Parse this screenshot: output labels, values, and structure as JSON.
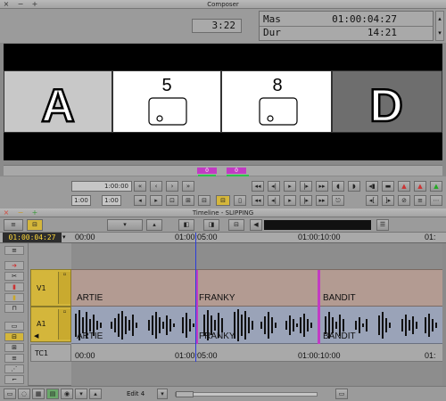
{
  "composer": {
    "title": "Composer",
    "duration_display": "3:22",
    "mas_label": "Mas",
    "mas_value": "01:00:04:27",
    "dur_label": "Dur",
    "dur_value": "14:21",
    "frames": [
      {
        "letter": "A",
        "number": "",
        "style": "light"
      },
      {
        "letter": "",
        "number": "5",
        "style": "white"
      },
      {
        "letter": "",
        "number": "8",
        "style": "white"
      },
      {
        "letter": "D",
        "number": "",
        "style": "dark"
      }
    ],
    "position_markers": [
      "0",
      "0"
    ],
    "timecode_field": "1:00:00",
    "in_field": "1:00",
    "out_field": "1:00"
  },
  "timeline": {
    "title": "Timeline - SLIPPING",
    "current_tc": "01:00:04:27",
    "ruler": [
      "00:00",
      "01:00:05:00",
      "01:00:10:00",
      "01:"
    ],
    "tracks": [
      {
        "name": "V1",
        "clips": [
          "ARTIE",
          "FRANKY",
          "BANDIT"
        ]
      },
      {
        "name": "A1",
        "clips": [
          "ARTIE",
          "FRANKY",
          "BANDIT"
        ]
      },
      {
        "name": "TC1",
        "labels": [
          "00:00",
          "01:00:05:00",
          "01:00:10:00",
          "01:"
        ]
      }
    ],
    "edit_label": "Edit 4"
  },
  "colors": {
    "accent_yellow": "#d4b63b",
    "magenta": "#c23bc3",
    "green": "#2ec44a",
    "video_track": "#b39b92",
    "audio_track": "#9aa3b8",
    "playhead": "#2a3cd9",
    "red_close": "#d24b3f"
  }
}
